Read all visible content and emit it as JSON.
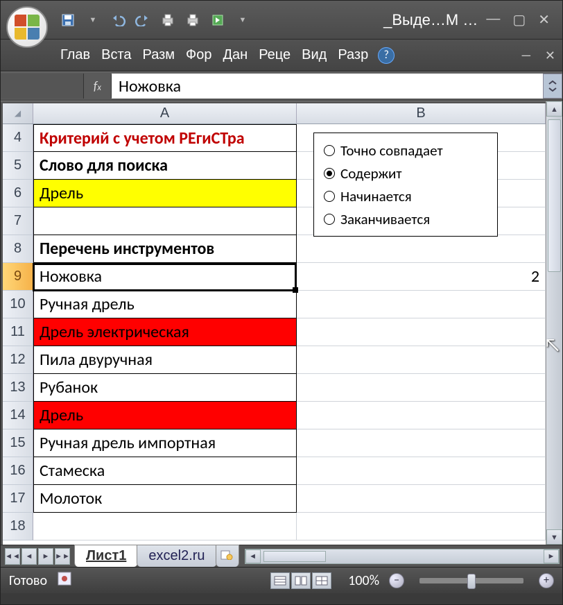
{
  "window_title": "_Выде…M …",
  "ribbon_tabs": [
    "Глав",
    "Вста",
    "Разм",
    "Фор",
    "Дан",
    "Реце",
    "Вид",
    "Разр"
  ],
  "formula_value": "Ножовка",
  "columns": [
    "A",
    "B"
  ],
  "rows": [
    {
      "n": 4,
      "a": "Критерий с учетом РЕгиСТра",
      "b": "",
      "a_cls": "red-bold"
    },
    {
      "n": 5,
      "a": "Слово для поиска",
      "b": "",
      "a_cls": "bold"
    },
    {
      "n": 6,
      "a": "Дрель",
      "b": "",
      "a_cls": "yellow-bg"
    },
    {
      "n": 7,
      "a": "",
      "b": ""
    },
    {
      "n": 8,
      "a": "Перечень инструментов",
      "b": "",
      "a_cls": "bold"
    },
    {
      "n": 9,
      "a": "Ножовка",
      "b": "2",
      "active": true
    },
    {
      "n": 10,
      "a": "Ручная дрель",
      "b": ""
    },
    {
      "n": 11,
      "a": "Дрель электрическая",
      "b": "",
      "a_cls": "red-bg"
    },
    {
      "n": 12,
      "a": "Пила двуручная",
      "b": ""
    },
    {
      "n": 13,
      "a": "Рубанок",
      "b": ""
    },
    {
      "n": 14,
      "a": "Дрель",
      "b": "",
      "a_cls": "red-bg"
    },
    {
      "n": 15,
      "a": "Ручная дрель импортная",
      "b": ""
    },
    {
      "n": 16,
      "a": "Стамеска",
      "b": ""
    },
    {
      "n": 17,
      "a": "Молоток",
      "b": ""
    },
    {
      "n": 18,
      "a": "",
      "b": ""
    }
  ],
  "radio_options": [
    {
      "label": "Точно совпадает",
      "checked": false
    },
    {
      "label": "Содержит",
      "checked": true
    },
    {
      "label": "Начинается",
      "checked": false
    },
    {
      "label": "Заканчивается",
      "checked": false
    }
  ],
  "sheet_tabs": [
    {
      "name": "Лист1",
      "active": true
    },
    {
      "name": "excel2.ru",
      "active": false
    }
  ],
  "status_text": "Готово",
  "zoom_label": "100%"
}
